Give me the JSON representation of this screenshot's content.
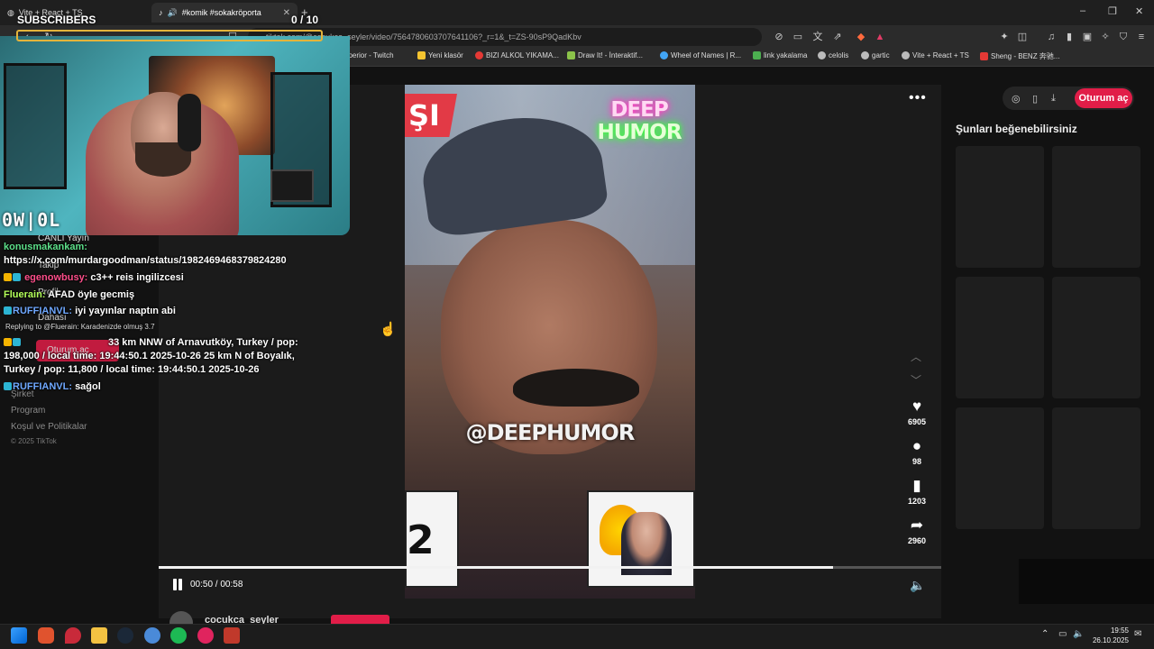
{
  "browser": {
    "tabs": [
      {
        "label": "Vite + React + TS"
      },
      {
        "label": "#komik #sokakröporta"
      }
    ],
    "url": "tiktok.com/@cocukca_seyler/video/7564780603707641106?_r=1&_t=ZS-90sP9QadKbv",
    "bookmarks": [
      {
        "label": "superior - Twitch",
        "color": "#9146ff"
      },
      {
        "label": "Yeni klasör",
        "color": "#f4c430"
      },
      {
        "label": "BIZI ALKOL YIKAMA...",
        "color": "#e53935"
      },
      {
        "label": "Draw It! - İnteraktif...",
        "color": "#8bc34a"
      },
      {
        "label": "Wheel of Names | R...",
        "color": "#42a5f5"
      },
      {
        "label": "link yakalama",
        "color": "#4caf50"
      },
      {
        "label": "celolis",
        "color": "#bbbbbb"
      },
      {
        "label": "gartic",
        "color": "#bbbbbb"
      },
      {
        "label": "Vite + React + TS",
        "color": "#bbbbbb"
      },
      {
        "label": "Sheng - BENZ 奔驰...",
        "color": "#e53935"
      }
    ]
  },
  "overlay": {
    "subscribers_label": "SUBSCRIBERS",
    "subscribers_count": "0 / 10",
    "logo": "0W|0L",
    "chat": [
      {
        "user": "konusmakankam:",
        "message": "",
        "user_color": "green"
      },
      {
        "user": "",
        "message": "https://x.com/murdargoodman/status/1982469468379824280",
        "user_color": "green"
      },
      {
        "user": "egenowbusy:",
        "message": "c3++ reis ingilizcesi",
        "user_color": "pink"
      },
      {
        "user": "Fluerain:",
        "message": "AFAD öyle gecmiş",
        "user_color": "lime"
      },
      {
        "user": "RUFFIANVL:",
        "message": "iyi yayınlar naptın abi",
        "user_color": "blue"
      },
      {
        "user": "",
        "message": "33 km NNW of Arnavutköy, Turkey / pop:",
        "user_color": "pink"
      },
      {
        "user": "",
        "message": "198,000 / local time: 19:44:50.1 2025-10-26 25 km N of Boyalık,",
        "user_color": "pink"
      },
      {
        "user": "",
        "message": "Turkey / pop: 11,800 / local time: 19:44:50.1 2025-10-26",
        "user_color": "pink"
      },
      {
        "user": "RUFFIANVL:",
        "message": "sağol",
        "user_color": "blue"
      }
    ],
    "reply_text": "Replying to @Fluerain: Karadenizde olmuş 3.7"
  },
  "tiktok": {
    "nav": {
      "live": "CANLI Yayın",
      "ghost_items": [
        "Takip",
        "Profil",
        "Dahası"
      ],
      "login_ghost": "Oturum aç"
    },
    "footer_links": [
      "Şirket",
      "Program",
      "Koşul ve Politikalar"
    ],
    "copyright": "© 2025 TikTok",
    "video": {
      "banner_text": "ŞI",
      "brand_line1": "DEEP",
      "brand_line2": "HUMOR",
      "watermark": "@DEEPHUMOR",
      "card_left_number": "2",
      "time": "00:50 / 00:58",
      "progress": 0.862
    },
    "actions": [
      {
        "icon": "heart-icon",
        "count": "6905"
      },
      {
        "icon": "comment-icon",
        "count": "98"
      },
      {
        "icon": "bookmark-icon",
        "count": "1203"
      },
      {
        "icon": "share-icon",
        "count": "2960"
      }
    ],
    "author": "cocukca_seyler",
    "login_button": "Oturum aç",
    "suggest_title": "Şunları beğenebilirsiniz"
  },
  "taskbar": {
    "time": "19:55",
    "date": "26.10.2025"
  },
  "colors": {
    "accent": "#e11d48",
    "sub_bar": "#e4b43b"
  }
}
